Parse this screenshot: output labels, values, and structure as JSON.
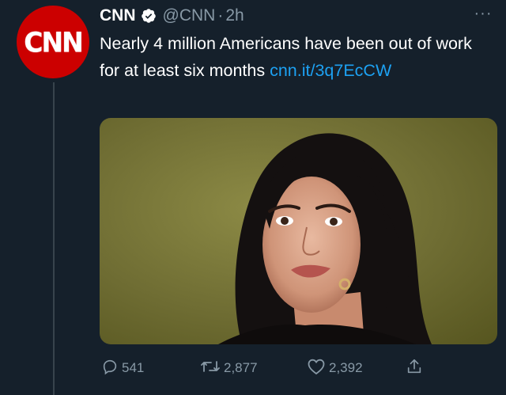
{
  "tweet": {
    "avatar_text": "CNN",
    "name": "CNN",
    "handle": "@CNN",
    "separator": "·",
    "time": "2h",
    "more_label": "···",
    "text": "Nearly 4 million Americans have been out of work for at least six months ",
    "link": "cnn.it/​3q7EcCW",
    "stats": {
      "replies": "541",
      "retweets": "2,877",
      "likes": "2,392"
    }
  },
  "icons": {
    "verified": "verified-badge-icon",
    "reply": "reply-icon",
    "retweet": "retweet-icon",
    "like": "heart-icon",
    "share": "share-icon",
    "more": "more-icon"
  },
  "colors": {
    "background": "#15202b",
    "brand": "#cc0000",
    "link": "#1da1f2",
    "muted": "#8899a6"
  }
}
